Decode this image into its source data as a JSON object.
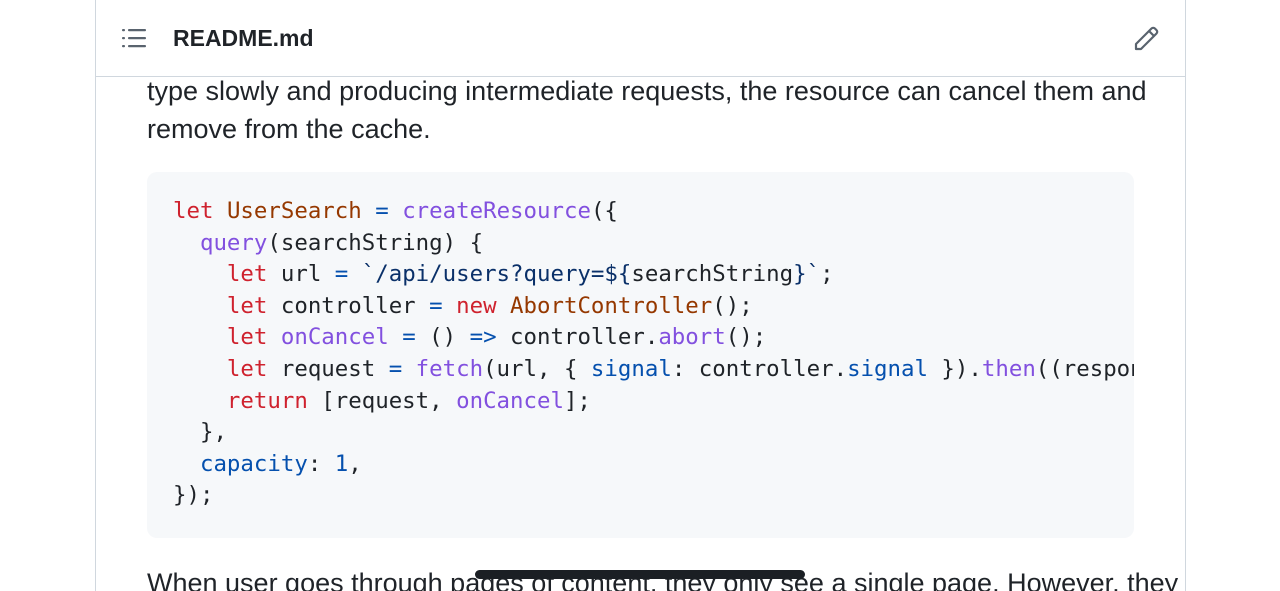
{
  "file_header": {
    "file_name": "README.md",
    "toc_icon": "list-unordered-icon",
    "edit_icon": "pencil-icon"
  },
  "content": {
    "paragraph_top": {
      "line1": "type slowly and producing intermediate requests, the resource can cancel them and",
      "line2": "remove from the cache."
    },
    "code_block": {
      "language": "javascript",
      "lines": [
        "let UserSearch = createResource({",
        "  query(searchString) {",
        "    let url = `/api/users?query=${searchString}`;",
        "    let controller = new AbortController();",
        "    let onCancel = () => controller.abort();",
        "    let request = fetch(url, { signal: controller.signal }).then((respons",
        "    return [request, onCancel];",
        "  },",
        "  capacity: 1,",
        "});"
      ]
    },
    "paragraph_bottom": {
      "line1": "When user goes through pages of content, they only see a single page. However, they"
    }
  },
  "colors": {
    "keyword": "#cf222e",
    "entity": "#953800",
    "function": "#8250df",
    "property": "#0550ae",
    "string": "#0a3069",
    "code_background": "#f6f8fa",
    "border": "#d0d7de"
  }
}
